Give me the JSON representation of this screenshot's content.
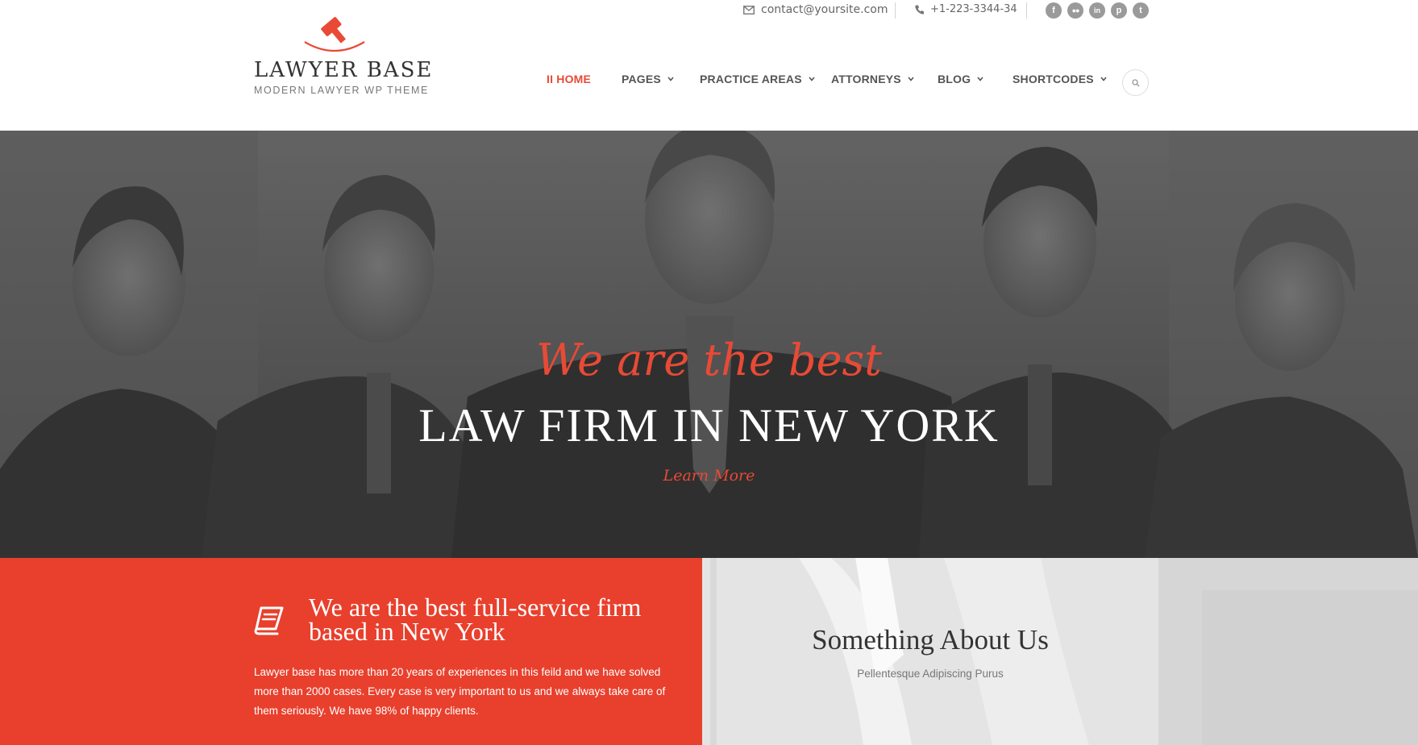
{
  "topbar": {
    "email": "contact@yoursite.com",
    "phone": "+1-223-3344-34",
    "socials": [
      {
        "name": "facebook-icon",
        "glyph": "f"
      },
      {
        "name": "flickr-icon",
        "glyph": "••"
      },
      {
        "name": "linkedin-icon",
        "glyph": "in"
      },
      {
        "name": "pinterest-icon",
        "glyph": "p"
      },
      {
        "name": "twitter-icon",
        "glyph": "t"
      }
    ]
  },
  "logo": {
    "title": "LAWYER BASE",
    "subtitle": "MODERN LAWYER WP THEME"
  },
  "nav": {
    "items": [
      {
        "label": "II HOME",
        "active": true,
        "dropdown": false
      },
      {
        "label": "PAGES",
        "active": false,
        "dropdown": true
      },
      {
        "label": "PRACTICE AREAS",
        "active": false,
        "dropdown": true
      },
      {
        "label": "ATTORNEYS",
        "active": false,
        "dropdown": true
      },
      {
        "label": "BLOG",
        "active": false,
        "dropdown": true
      },
      {
        "label": "SHORTCODES",
        "active": false,
        "dropdown": true
      }
    ]
  },
  "hero": {
    "script": "We are the best",
    "title": "LAW FIRM IN NEW YORK",
    "link": "Learn More"
  },
  "intro": {
    "heading": "We are the best full-service firm based in New York",
    "body": "Lawyer base has more than 20 years of experiences in this feild and we have solved more than 2000 cases. Every case is very important to us and we always take care of them seriously. We have 98% of happy clients."
  },
  "about": {
    "heading": "Something About Us",
    "subheading": "Pellentesque Adipiscing Purus"
  },
  "colors": {
    "accent": "#e84a36",
    "panel_red": "#e8402d",
    "hero_overlay": "#4a4a4a"
  }
}
